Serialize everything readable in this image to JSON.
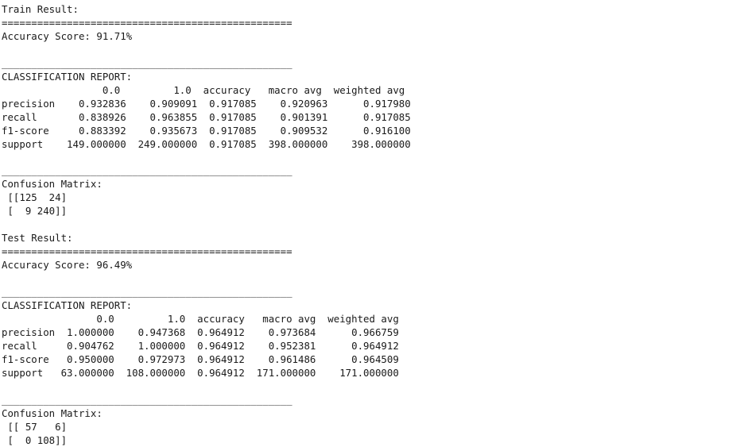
{
  "output": {
    "kind": "stdout-text",
    "sections": [
      {
        "id": "train",
        "heading": "Train Result:",
        "rule_equals": "=================================================",
        "accuracy_line": "Accuracy Score: 91.71%",
        "blank_after_accuracy": "",
        "rule_underscore": "_________________________________________________",
        "report_title": "CLASSIFICATION REPORT:",
        "report_header": "                 0.0         1.0  accuracy   macro avg  weighted avg",
        "report_rows": [
          "precision    0.932836    0.909091  0.917085    0.920963      0.917980",
          "recall       0.838926    0.963855  0.917085    0.901391      0.917085",
          "f1-score     0.883392    0.935673  0.917085    0.909532      0.916100",
          "support    149.000000  249.000000  0.917085  398.000000    398.000000"
        ],
        "rule_underscore_2": "_________________________________________________",
        "confusion_title": "Confusion Matrix:",
        "confusion_rows": [
          " [[125  24]",
          " [  9 240]]"
        ]
      },
      {
        "id": "test",
        "heading": "Test Result:",
        "rule_equals": "=================================================",
        "accuracy_line": "Accuracy Score: 96.49%",
        "blank_after_accuracy": "",
        "rule_underscore": "_________________________________________________",
        "report_title": "CLASSIFICATION REPORT:",
        "report_header": "                0.0         1.0  accuracy   macro avg  weighted avg",
        "report_rows": [
          "precision  1.000000    0.947368  0.964912    0.973684      0.966759",
          "recall     0.904762    1.000000  0.964912    0.952381      0.964912",
          "f1-score   0.950000    0.972973  0.964912    0.961486      0.964509",
          "support   63.000000  108.000000  0.964912  171.000000    171.000000"
        ],
        "rule_underscore_2": "_________________________________________________",
        "confusion_title": "Confusion Matrix:",
        "confusion_rows": [
          " [[ 57   6]",
          " [  0 108]]"
        ]
      }
    ]
  },
  "metrics": {
    "train": {
      "accuracy_percent": "91.71%",
      "classes": [
        "0.0",
        "1.0"
      ],
      "columns": [
        "0.0",
        "1.0",
        "accuracy",
        "macro avg",
        "weighted avg"
      ],
      "rows": [
        "precision",
        "recall",
        "f1-score",
        "support"
      ],
      "values": {
        "precision": [
          "0.932836",
          "0.909091",
          "0.917085",
          "0.920963",
          "0.917980"
        ],
        "recall": [
          "0.838926",
          "0.963855",
          "0.917085",
          "0.901391",
          "0.917085"
        ],
        "f1-score": [
          "0.883392",
          "0.935673",
          "0.917085",
          "0.909532",
          "0.916100"
        ],
        "support": [
          "149.000000",
          "249.000000",
          "0.917085",
          "398.000000",
          "398.000000"
        ]
      },
      "confusion_matrix": [
        [
          125,
          24
        ],
        [
          9,
          240
        ]
      ]
    },
    "test": {
      "accuracy_percent": "96.49%",
      "classes": [
        "0.0",
        "1.0"
      ],
      "columns": [
        "0.0",
        "1.0",
        "accuracy",
        "macro avg",
        "weighted avg"
      ],
      "rows": [
        "precision",
        "recall",
        "f1-score",
        "support"
      ],
      "values": {
        "precision": [
          "1.000000",
          "0.947368",
          "0.964912",
          "0.973684",
          "0.966759"
        ],
        "recall": [
          "0.904762",
          "1.000000",
          "0.964912",
          "0.952381",
          "0.964912"
        ],
        "f1-score": [
          "0.950000",
          "0.972973",
          "0.964912",
          "0.961486",
          "0.964509"
        ],
        "support": [
          "63.000000",
          "108.000000",
          "0.964912",
          "171.000000",
          "171.000000"
        ]
      },
      "confusion_matrix": [
        [
          57,
          6
        ],
        [
          0,
          108
        ]
      ]
    }
  },
  "colors": {
    "background": "#ffffff",
    "text": "#1a1a1a"
  }
}
